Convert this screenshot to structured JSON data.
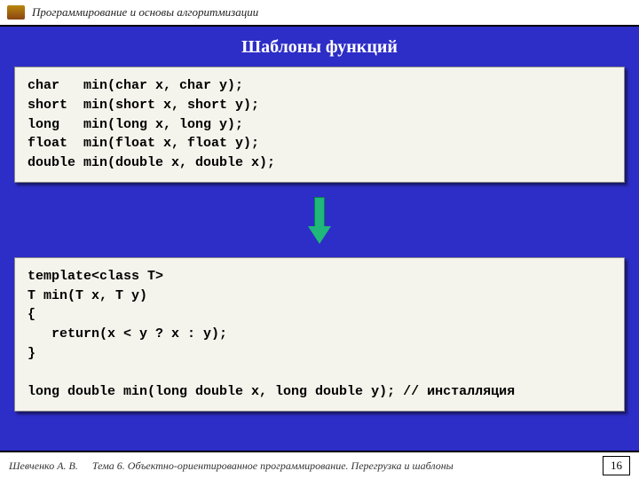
{
  "header": {
    "title": "Программирование и основы алгоритмизации"
  },
  "slide": {
    "title": "Шаблоны функций"
  },
  "code1": "char   min(char x, char y);\nshort  min(short x, short y);\nlong   min(long x, long y);\nfloat  min(float x, float y);\ndouble min(double x, double x);",
  "code2": "template<class T>\nT min(T x, T y)\n{\n   return(x < y ? x : y);\n}\n\nlong double min(long double x, long double y); // инсталляция",
  "footer": {
    "author": "Шевченко А. В.",
    "topic": "Тема 6. Объектно-ориентированное программирование. Перегрузка и шаблоны",
    "page": "16"
  }
}
